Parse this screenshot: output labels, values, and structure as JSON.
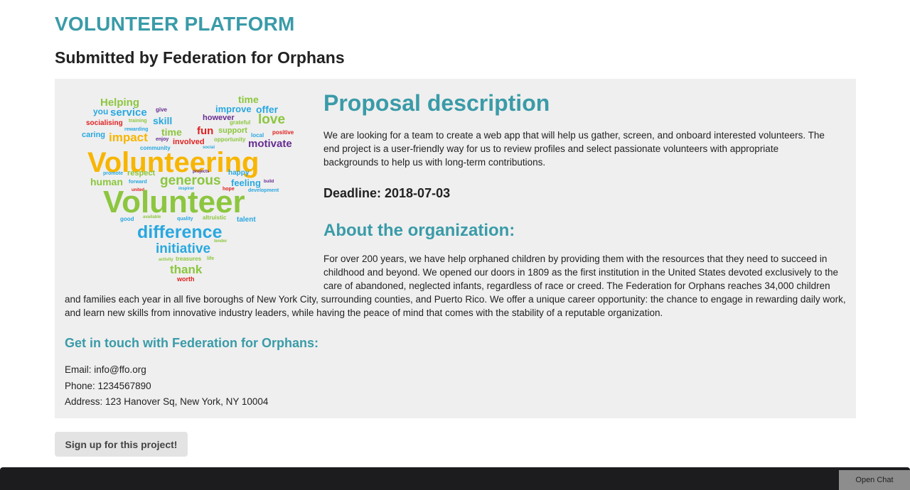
{
  "site_title": "VOLUNTEER PLATFORM",
  "submitted_by": "Submitted by Federation for Orphans",
  "image": {
    "description_words": [
      "Helping",
      "time",
      "you",
      "service",
      "give",
      "improve",
      "offer",
      "socialising",
      "training",
      "skill",
      "however",
      "love",
      "caring",
      "rewarding",
      "impact",
      "time",
      "fun",
      "grateful",
      "enjoy",
      "involved",
      "support",
      "local",
      "positive",
      "community",
      "opportunity",
      "social",
      "motivate",
      "Volunteering",
      "promote",
      "respect",
      "projects",
      "happy",
      "human",
      "forward",
      "generous",
      "feeling",
      "build",
      "united",
      "inspirer",
      "hope",
      "development",
      "Volunteer",
      "good",
      "available",
      "quality",
      "altruistic",
      "talent",
      "difference",
      "tender",
      "initiative",
      "activity",
      "treasures",
      "life",
      "thank",
      "worth"
    ]
  },
  "proposal": {
    "heading": "Proposal description",
    "text": "We are looking for a team to create a web app that will help us gather, screen, and onboard interested volunteers. The end project is a user-friendly way for us to review profiles and select passionate volunteers with appropriate backgrounds to help us with long-term contributions.",
    "deadline": "Deadline: 2018-07-03"
  },
  "about": {
    "heading": "About the organization:",
    "text": "For over 200 years, we have help orphaned children by providing them with the resources that they need to succeed in childhood and beyond. We opened our doors in 1809 as the first institution in the United States devoted exclusively to the care of abandoned, neglected infants, regardless of race or creed. The Federation for Orphans reaches 34,000 children and families each year in all five boroughs of New York City, surrounding counties, and Puerto Rico. We offer a unique career opportunity: the chance to engage in rewarding daily work, and learn new skills from innovative industry leaders, while having the peace of mind that comes with the stability of a reputable organization."
  },
  "contact": {
    "heading": "Get in touch with Federation for Orphans:",
    "email": "Email: info@ffo.org",
    "phone": "Phone: 1234567890",
    "address": "Address: 123 Hanover Sq, New York, NY 10004"
  },
  "signup_button": "Sign up for this project!",
  "open_chat_button": "Open Chat",
  "colors": {
    "accent": "#3a9ba8",
    "panel_bg": "#efefef",
    "footer_bg": "#1c1c1e",
    "wc_blue": "#29a8e0",
    "wc_green": "#8cc63f",
    "wc_yellow": "#f7b500",
    "wc_orange": "#f7941d",
    "wc_red": "#e02020",
    "wc_purple": "#662d91"
  }
}
